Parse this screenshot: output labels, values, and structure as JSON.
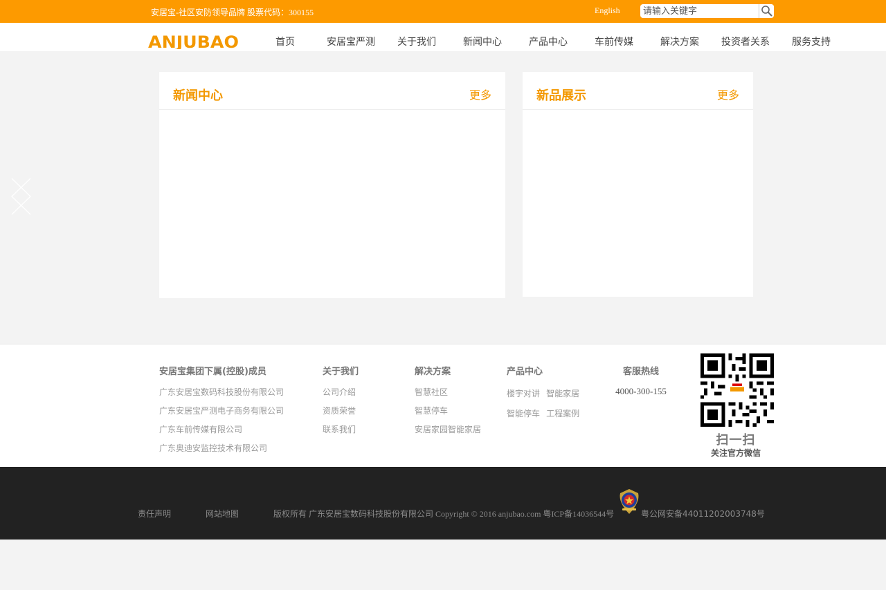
{
  "topbar": {
    "slogan": "安居宝-社区安防领导品牌 股票代码：300155",
    "english_link": "English",
    "search_placeholder": "请输入关键字"
  },
  "header": {
    "logo_text": "ANJUBAO",
    "nav": [
      "首页",
      "安居宝严测",
      "关于我们",
      "新闻中心",
      "产品中心",
      "车前传媒",
      "解决方案",
      "投资者关系",
      "服务支持"
    ]
  },
  "panels": {
    "news": {
      "title": "新闻中心",
      "more": "更多"
    },
    "products": {
      "title": "新品展示",
      "more": "更多"
    }
  },
  "footer": {
    "group": {
      "title": "安居宝集团下属(控股)成员",
      "links": [
        "广东安居宝数码科技股份有限公司",
        "广东安居宝严测电子商务有限公司",
        "广东车前传媒有限公司",
        "广东奥迪安监控技术有限公司"
      ]
    },
    "about": {
      "title": "关于我们",
      "links": [
        "公司介绍",
        "资质荣誉",
        "联系我们"
      ]
    },
    "solutions": {
      "title": "解决方案",
      "links": [
        "智慧社区",
        "智慧停车",
        "安居家园智能家居"
      ]
    },
    "products": {
      "title": "产品中心",
      "row1": [
        "楼宇对讲",
        "智能家居"
      ],
      "row2": [
        "智能停车",
        "工程案例"
      ]
    },
    "hotline": {
      "title": "客服热线",
      "number": "4000-300-155"
    },
    "qr": {
      "scan_text": "扫一扫",
      "follow_text": "关注官方微信"
    }
  },
  "bottombar": {
    "disclaimer": "责任声明",
    "sitemap": "网站地图",
    "copyright": "版权所有 广东安居宝数码科技股份有限公司 Copyright © 2016 anjubao.com 粤ICP备14036544号",
    "police_record": "粤公网安备44011202003748号"
  },
  "colors": {
    "brand_orange": "#fd9a00",
    "title_orange": "#f39800",
    "footer_dark": "#222222",
    "page_bg": "#f3f3f3"
  }
}
